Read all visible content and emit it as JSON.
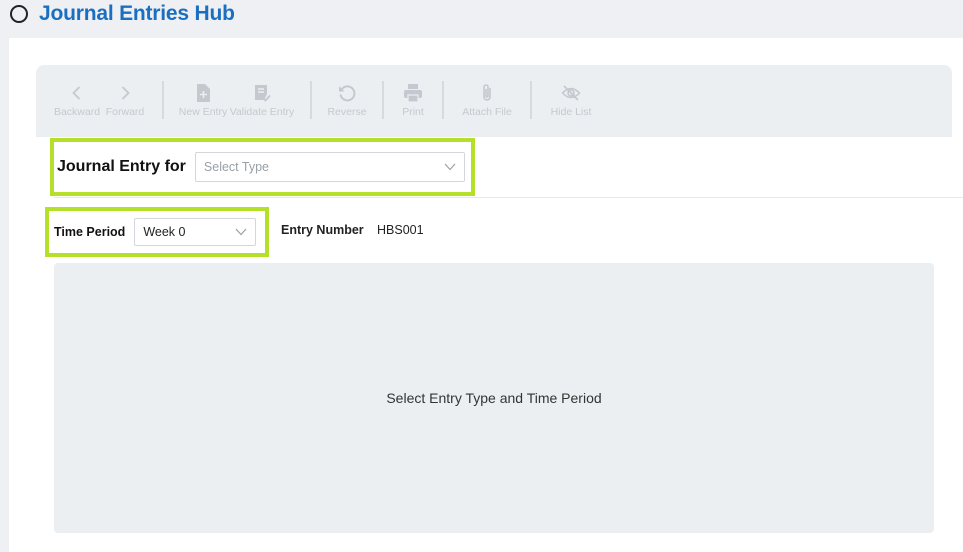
{
  "header": {
    "title": "Journal Entries Hub"
  },
  "toolbar": {
    "backward": "Backward",
    "forward": "Forward",
    "new_entry": "New Entry",
    "validate_entry": "Validate Entry",
    "reverse": "Reverse",
    "print": "Print",
    "attach_file": "Attach File",
    "hide_list": "Hide List"
  },
  "form": {
    "journal_entry_label": "Journal Entry for",
    "select_type_placeholder": "Select Type",
    "time_period_label": "Time Period",
    "time_period_value": "Week 0",
    "entry_number_label": "Entry Number",
    "entry_number_value": "HBS001"
  },
  "content": {
    "placeholder": "Select Entry Type and Time Period"
  },
  "colors": {
    "title": "#1b6fc0",
    "highlight": "#b5e02a",
    "toolbar_bg": "#eceff2",
    "disabled_icon": "#c4c9cf"
  }
}
